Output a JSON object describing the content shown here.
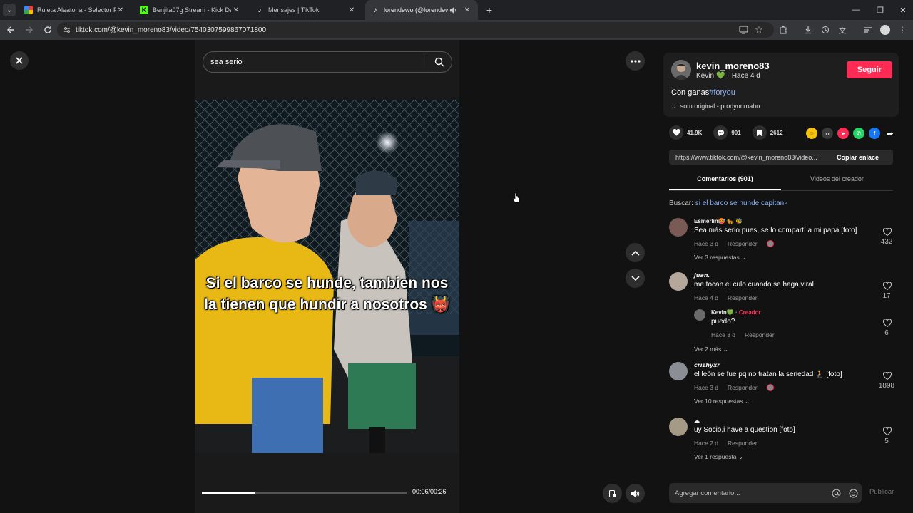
{
  "browser": {
    "tabs": [
      {
        "title": "Ruleta Aleatoria - Selector Persona",
        "favicon_color": "#4f8df5",
        "active": false
      },
      {
        "title": "Benjita07g Stream - Kick Dashboard",
        "favicon_color": "#53fc18",
        "active": false
      },
      {
        "title": "Mensajes | TikTok",
        "favicon_color": "#111111",
        "active": false
      },
      {
        "title": "lorendewo (@lorendewo) | TikTok",
        "favicon_color": "#111111",
        "active": true
      }
    ],
    "url": "tiktok.com/@kevin_moreno83/video/7540307599867071800"
  },
  "player": {
    "search_value": "sea serio",
    "caption": "Si el barco se hunde, tambien nos la tienen que hundir a nosotros 👹",
    "time": "00:06/00:26",
    "progress": 0.26
  },
  "post": {
    "username": "kevin_moreno83",
    "display_name": "Kevin",
    "verified_emoji": "💚",
    "time_ago": "Hace 4 d",
    "follow_label": "Seguir",
    "description": "Con ganas",
    "hashtag": "#foryou",
    "music": "som original - prodyunmaho",
    "likes": "41.9K",
    "comments": "901",
    "saves": "2612",
    "link": "https://www.tiktok.com/@kevin_moreno83/video...",
    "copy_label": "Copiar enlace",
    "tab_comments": "Comentarios (901)",
    "tab_videos": "Videos del creador",
    "search_prefix": "Buscar:",
    "search_query": "si el barco se hunde capitan"
  },
  "comments": [
    {
      "name": "Esmerlin🥵 🐆 🐝",
      "text": "Sea más serio pues, se lo compartí a mi papá [foto]",
      "time": "Hace 3 d",
      "reply": "Responder",
      "likes": "432",
      "more": "Ver 3 respuestas",
      "avatar_color": "#7a5a55"
    },
    {
      "name": "𝙟𝙪𝙖𝙣.",
      "text": "me tocan el culo cuando se haga viral",
      "time": "Hace 4 d",
      "reply": "Responder",
      "likes": "17",
      "more": "Ver 2 más",
      "avatar_color": "#b5a89a"
    },
    {
      "name": "𝙘𝙧𝙞𝙨𝙝𝙮𝙭𝙧",
      "text": "el león se fue pq no tratan la seriedad 🧎 [foto]",
      "time": "Hace 3 d",
      "reply": "Responder",
      "likes": "1898",
      "more": "Ver 10 respuestas",
      "avatar_color": "#8b8f95"
    },
    {
      "name": "☁",
      "text": "uy Socio,i have a question [foto]",
      "time": "Hace 2 d",
      "reply": "Responder",
      "likes": "5",
      "more": "Ver 1 respuesta",
      "avatar_color": "#a59a86"
    }
  ],
  "sub_reply": {
    "name": "Kevin💚",
    "badge": "Creador",
    "text": "puedo?",
    "time": "Hace 3 d",
    "reply": "Responder",
    "likes": "6"
  },
  "composer": {
    "placeholder": "Agregar comentario...",
    "post_label": "Publicar"
  }
}
